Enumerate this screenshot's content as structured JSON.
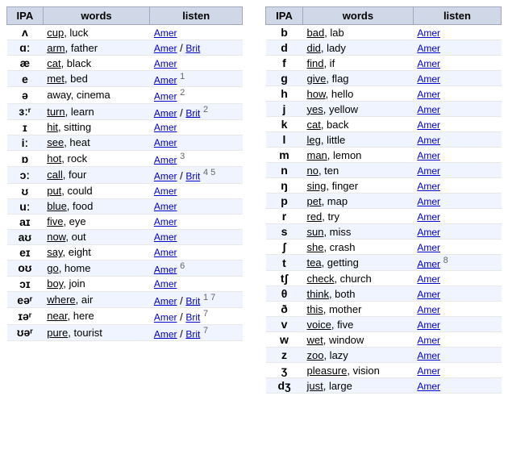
{
  "table1": {
    "headers": [
      "IPA",
      "words",
      "listen"
    ],
    "rows": [
      {
        "ipa": "ʌ",
        "words": [
          [
            "cup",
            true
          ],
          ", ",
          [
            "luck",
            false
          ]
        ],
        "amer": "Amer",
        "brit": null,
        "note": ""
      },
      {
        "ipa": "ɑː",
        "words": [
          [
            "arm",
            true
          ],
          ", ",
          [
            "father",
            false
          ]
        ],
        "amer": "Amer",
        "brit": "Brit",
        "note": ""
      },
      {
        "ipa": "æ",
        "words": [
          [
            "cat",
            true
          ],
          ", ",
          [
            "black",
            false
          ]
        ],
        "amer": "Amer",
        "brit": null,
        "note": ""
      },
      {
        "ipa": "e",
        "words": [
          [
            "met",
            true
          ],
          ", ",
          [
            "bed",
            false
          ]
        ],
        "amer": "Amer",
        "brit": null,
        "note": "1"
      },
      {
        "ipa": "ə",
        "words": [
          [
            "away",
            false
          ],
          ", ",
          [
            "cinema",
            false
          ]
        ],
        "amer": "Amer",
        "brit": null,
        "note": "2"
      },
      {
        "ipa": "ɜːʳ",
        "words": [
          [
            "turn",
            true
          ],
          ", ",
          [
            "learn",
            false
          ]
        ],
        "amer": "Amer",
        "brit": "Brit",
        "note": "2"
      },
      {
        "ipa": "ɪ",
        "words": [
          [
            "hit",
            true
          ],
          ", ",
          [
            "sitting",
            false
          ]
        ],
        "amer": "Amer",
        "brit": null,
        "note": ""
      },
      {
        "ipa": "iː",
        "words": [
          [
            "see",
            true
          ],
          ", ",
          [
            "heat",
            false
          ]
        ],
        "amer": "Amer",
        "brit": null,
        "note": ""
      },
      {
        "ipa": "ɒ",
        "words": [
          [
            "hot",
            true
          ],
          ", ",
          [
            "rock",
            false
          ]
        ],
        "amer": "Amer",
        "brit": null,
        "note": "3"
      },
      {
        "ipa": "ɔː",
        "words": [
          [
            "call",
            true
          ],
          ", ",
          [
            "four",
            false
          ]
        ],
        "amer": "Amer",
        "brit": "Brit",
        "note": "4 5"
      },
      {
        "ipa": "ʊ",
        "words": [
          [
            "put",
            true
          ],
          ", ",
          [
            "could",
            false
          ]
        ],
        "amer": "Amer",
        "brit": null,
        "note": ""
      },
      {
        "ipa": "uː",
        "words": [
          [
            "blue",
            true
          ],
          ", ",
          [
            "food",
            false
          ]
        ],
        "amer": "Amer",
        "brit": null,
        "note": ""
      },
      {
        "ipa": "aɪ",
        "words": [
          [
            "five",
            true
          ],
          ", ",
          [
            "eye",
            false
          ]
        ],
        "amer": "Amer",
        "brit": null,
        "note": ""
      },
      {
        "ipa": "aʊ",
        "words": [
          [
            "now",
            true
          ],
          ", ",
          [
            "out",
            false
          ]
        ],
        "amer": "Amer",
        "brit": null,
        "note": ""
      },
      {
        "ipa": "eɪ",
        "words": [
          [
            "say",
            true
          ],
          ", ",
          [
            "eight",
            false
          ]
        ],
        "amer": "Amer",
        "brit": null,
        "note": ""
      },
      {
        "ipa": "oʊ",
        "words": [
          [
            "go",
            true
          ],
          ", ",
          [
            "home",
            false
          ]
        ],
        "amer": "Amer",
        "brit": null,
        "note": "6"
      },
      {
        "ipa": "ɔɪ",
        "words": [
          [
            "boy",
            true
          ],
          ", ",
          [
            "join",
            false
          ]
        ],
        "amer": "Amer",
        "brit": null,
        "note": ""
      },
      {
        "ipa": "eəʳ",
        "words": [
          [
            "where",
            true
          ],
          ", ",
          [
            "air",
            false
          ]
        ],
        "amer": "Amer",
        "brit": "Brit",
        "note": "1 7"
      },
      {
        "ipa": "ɪəʳ",
        "words": [
          [
            "near",
            true
          ],
          ", ",
          [
            "here",
            false
          ]
        ],
        "amer": "Amer",
        "brit": "Brit",
        "note": "7"
      },
      {
        "ipa": "ʊəʳ",
        "words": [
          [
            "pure",
            true
          ],
          ", ",
          [
            "tourist",
            false
          ]
        ],
        "amer": "Amer",
        "brit": "Brit",
        "note": "7"
      }
    ]
  },
  "table2": {
    "headers": [
      "IPA",
      "words",
      "listen"
    ],
    "rows": [
      {
        "ipa": "b",
        "words": [
          [
            "bad",
            true
          ],
          ", ",
          [
            "lab",
            false
          ]
        ],
        "amer": "Amer",
        "brit": null,
        "note": ""
      },
      {
        "ipa": "d",
        "words": [
          [
            "did",
            true
          ],
          ", ",
          [
            "lady",
            false
          ]
        ],
        "amer": "Amer",
        "brit": null,
        "note": ""
      },
      {
        "ipa": "f",
        "words": [
          [
            "find",
            true
          ],
          ", ",
          [
            "if",
            false
          ]
        ],
        "amer": "Amer",
        "brit": null,
        "note": ""
      },
      {
        "ipa": "g",
        "words": [
          [
            "give",
            true
          ],
          ", ",
          [
            "flag",
            false
          ]
        ],
        "amer": "Amer",
        "brit": null,
        "note": ""
      },
      {
        "ipa": "h",
        "words": [
          [
            "how",
            true
          ],
          ", ",
          [
            "hello",
            false
          ]
        ],
        "amer": "Amer",
        "brit": null,
        "note": ""
      },
      {
        "ipa": "j",
        "words": [
          [
            "yes",
            true
          ],
          ", ",
          [
            "yellow",
            false
          ]
        ],
        "amer": "Amer",
        "brit": null,
        "note": ""
      },
      {
        "ipa": "k",
        "words": [
          [
            "cat",
            true
          ],
          ", ",
          [
            "back",
            false
          ]
        ],
        "amer": "Amer",
        "brit": null,
        "note": ""
      },
      {
        "ipa": "l",
        "words": [
          [
            "leg",
            true
          ],
          ", ",
          [
            "little",
            false
          ]
        ],
        "amer": "Amer",
        "brit": null,
        "note": ""
      },
      {
        "ipa": "m",
        "words": [
          [
            "man",
            true
          ],
          ", ",
          [
            "lemon",
            false
          ]
        ],
        "amer": "Amer",
        "brit": null,
        "note": ""
      },
      {
        "ipa": "n",
        "words": [
          [
            "no",
            true
          ],
          ", ",
          [
            "ten",
            false
          ]
        ],
        "amer": "Amer",
        "brit": null,
        "note": ""
      },
      {
        "ipa": "ŋ",
        "words": [
          [
            "sing",
            true
          ],
          ", ",
          [
            "finger",
            false
          ]
        ],
        "amer": "Amer",
        "brit": null,
        "note": ""
      },
      {
        "ipa": "p",
        "words": [
          [
            "pet",
            true
          ],
          ", ",
          [
            "map",
            false
          ]
        ],
        "amer": "Amer",
        "brit": null,
        "note": ""
      },
      {
        "ipa": "r",
        "words": [
          [
            "red",
            true
          ],
          ", ",
          [
            "try",
            false
          ]
        ],
        "amer": "Amer",
        "brit": null,
        "note": ""
      },
      {
        "ipa": "s",
        "words": [
          [
            "sun",
            true
          ],
          ", ",
          [
            "miss",
            false
          ]
        ],
        "amer": "Amer",
        "brit": null,
        "note": ""
      },
      {
        "ipa": "ʃ",
        "words": [
          [
            "she",
            true
          ],
          ", ",
          [
            "crash",
            false
          ]
        ],
        "amer": "Amer",
        "brit": null,
        "note": ""
      },
      {
        "ipa": "t",
        "words": [
          [
            "tea",
            true
          ],
          ", ",
          [
            "getting",
            false
          ]
        ],
        "amer": "Amer",
        "brit": null,
        "note": "8"
      },
      {
        "ipa": "tʃ",
        "words": [
          [
            "check",
            true
          ],
          ", ",
          [
            "church",
            false
          ]
        ],
        "amer": "Amer",
        "brit": null,
        "note": ""
      },
      {
        "ipa": "θ",
        "words": [
          [
            "think",
            true
          ],
          ", ",
          [
            "both",
            false
          ]
        ],
        "amer": "Amer",
        "brit": null,
        "note": ""
      },
      {
        "ipa": "ð",
        "words": [
          [
            "this",
            true
          ],
          ", ",
          [
            "mother",
            false
          ]
        ],
        "amer": "Amer",
        "brit": null,
        "note": ""
      },
      {
        "ipa": "v",
        "words": [
          [
            "voice",
            true
          ],
          ", ",
          [
            "five",
            false
          ]
        ],
        "amer": "Amer",
        "brit": null,
        "note": ""
      },
      {
        "ipa": "w",
        "words": [
          [
            "wet",
            true
          ],
          ", ",
          [
            "window",
            false
          ]
        ],
        "amer": "Amer",
        "brit": null,
        "note": ""
      },
      {
        "ipa": "z",
        "words": [
          [
            "zoo",
            true
          ],
          ", ",
          [
            "lazy",
            false
          ]
        ],
        "amer": "Amer",
        "brit": null,
        "note": ""
      },
      {
        "ipa": "ʒ",
        "words": [
          [
            "pleasure",
            true
          ],
          ", ",
          [
            "vision",
            false
          ]
        ],
        "amer": "Amer",
        "brit": null,
        "note": ""
      },
      {
        "ipa": "dʒ",
        "words": [
          [
            "just",
            true
          ],
          ", ",
          [
            "large",
            false
          ]
        ],
        "amer": "Amer",
        "brit": null,
        "note": ""
      }
    ]
  }
}
